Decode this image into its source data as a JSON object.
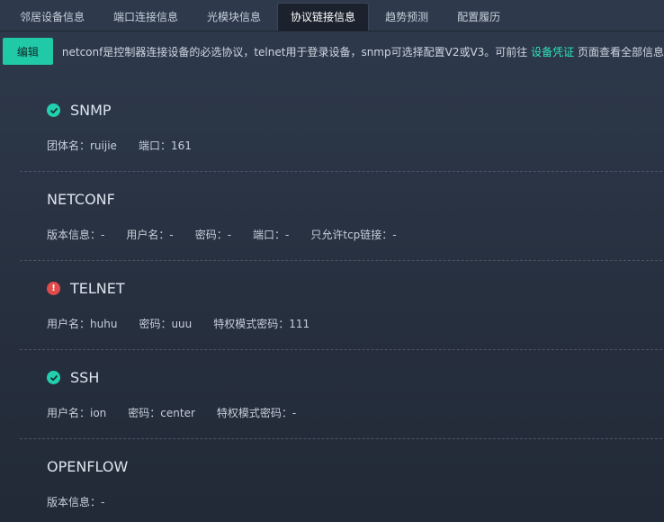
{
  "tabs": [
    {
      "label": "邻居设备信息"
    },
    {
      "label": "端口连接信息"
    },
    {
      "label": "光模块信息"
    },
    {
      "label": "协议链接信息"
    },
    {
      "label": "趋势预测"
    },
    {
      "label": "配置履历"
    }
  ],
  "toolbar": {
    "edit_label": "编辑",
    "info_prefix": "netconf是控制器连接设备的必选协议，telnet用于登录设备，snmp可选择配置V2或V3。可前往",
    "info_link": "设备凭证",
    "info_suffix": "页面查看全部信息"
  },
  "sections": {
    "snmp": {
      "title": "SNMP",
      "status_icon": "check-circle-icon",
      "fields": [
        "团体名：ruijie",
        "端口：161"
      ]
    },
    "netconf": {
      "title": "NETCONF",
      "fields": [
        "版本信息：-",
        "用户名：-",
        "密码：-",
        "端口：-",
        "只允许tcp链接：-"
      ]
    },
    "telnet": {
      "title": "TELNET",
      "status_icon": "alert-circle-icon",
      "fields": [
        "用户名：huhu",
        "密码：uuu",
        "特权模式密码：111"
      ]
    },
    "ssh": {
      "title": "SSH",
      "status_icon": "check-circle-icon",
      "fields": [
        "用户名：ion",
        "密码：center",
        "特权模式密码：-"
      ]
    },
    "openflow": {
      "title": "OPENFLOW",
      "fields": [
        "版本信息：-"
      ]
    }
  },
  "colors": {
    "accent": "#20c9a8",
    "link": "#2fe3c0",
    "error": "#e14b4b",
    "background": "#2a3444"
  }
}
